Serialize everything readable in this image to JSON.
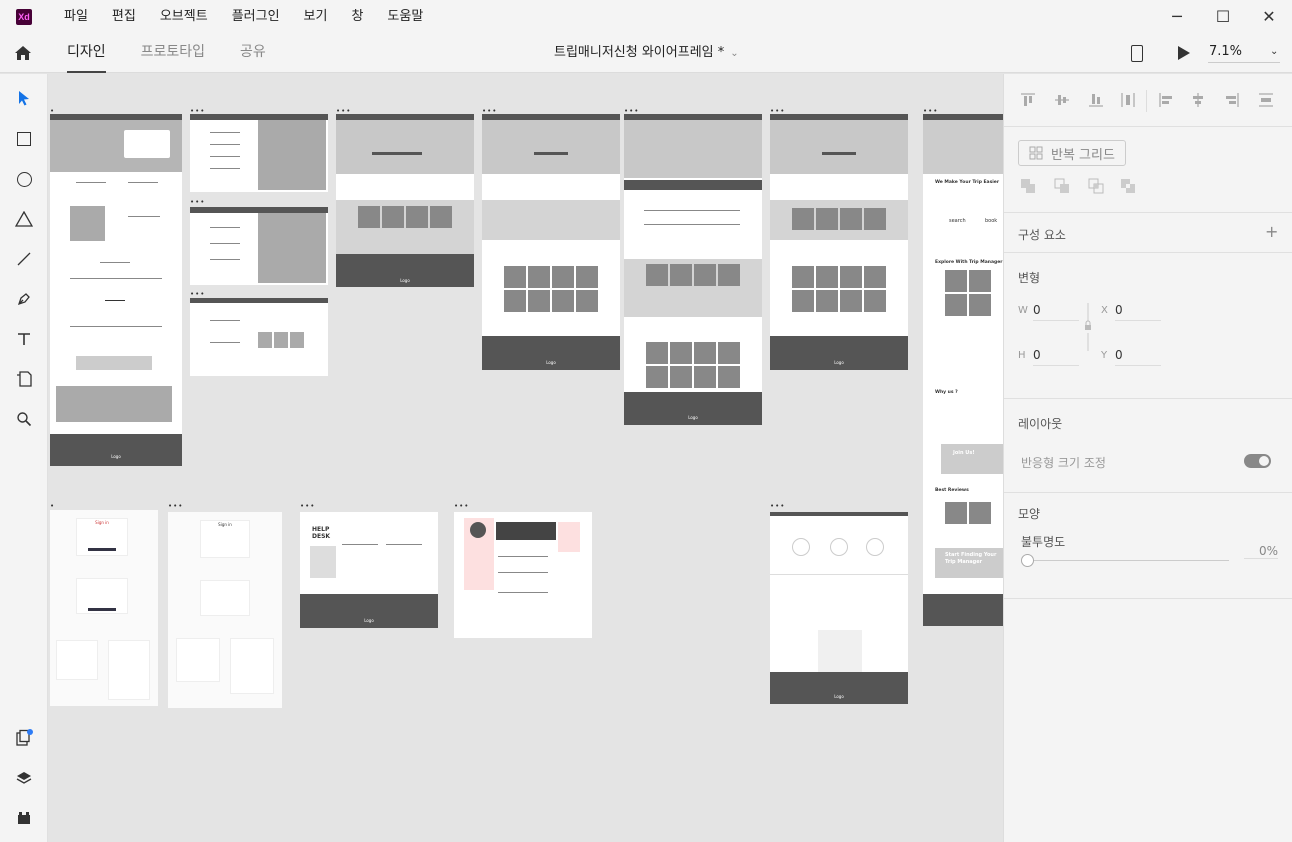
{
  "app": {
    "logo_text": "Xd",
    "menu": [
      "파일",
      "편집",
      "오브젝트",
      "플러그인",
      "보기",
      "창",
      "도움말"
    ],
    "window_controls": [
      "─",
      "☐",
      "✕"
    ]
  },
  "tabs": [
    "디자인",
    "프로토타입",
    "공유"
  ],
  "active_tab": "디자인",
  "document": {
    "title": "트립매니저신청 와이어프레임 *",
    "chevron": "⌄"
  },
  "zoom": {
    "value": "7.1%",
    "chevron": "⌄"
  },
  "tools": [
    "select-icon",
    "rectangle-icon",
    "ellipse-icon",
    "triangle-icon",
    "line-icon",
    "pen-icon",
    "text-icon",
    "artboard-icon",
    "zoom-icon"
  ],
  "bottom_tools": [
    "plugins-icon",
    "layers-icon",
    "assets-icon"
  ],
  "canvas": {
    "artboard_dots": "•••",
    "artboard_dot": "•",
    "texts": {
      "help_desk": "HELP\nDESK",
      "logo": "Logo",
      "signin": "Sign in",
      "we_make": "We Make Your Trip Easier",
      "explore": "Explore With Trip Manager",
      "why_us": "Why us ?",
      "best_reviews": "Best Reviews",
      "start_finding": "Start Finding Your\nTrip Manager",
      "join_us": "Join Us!",
      "search": "search",
      "book": "book"
    }
  },
  "panel": {
    "repeat_grid": "반복 그리드",
    "components": "구성 요소",
    "components_add": "+",
    "transform": "변형",
    "w_label": "W",
    "w_value": "0",
    "x_label": "X",
    "x_value": "0",
    "h_label": "H",
    "h_value": "0",
    "y_label": "Y",
    "y_value": "0",
    "layout": "레이아웃",
    "responsive_resize": "반응형 크기 조정",
    "responsive_resize_on": true,
    "appearance": "모양",
    "opacity_label": "불투명도",
    "opacity_value": "0%",
    "opacity_level": 0
  },
  "colors": {
    "app_bg": "#f4f4f4",
    "canvas_bg": "#e4e4e4",
    "xd_brand": "#470137",
    "xd_accent": "#ff61f6",
    "notification": "#2d7cf6"
  }
}
